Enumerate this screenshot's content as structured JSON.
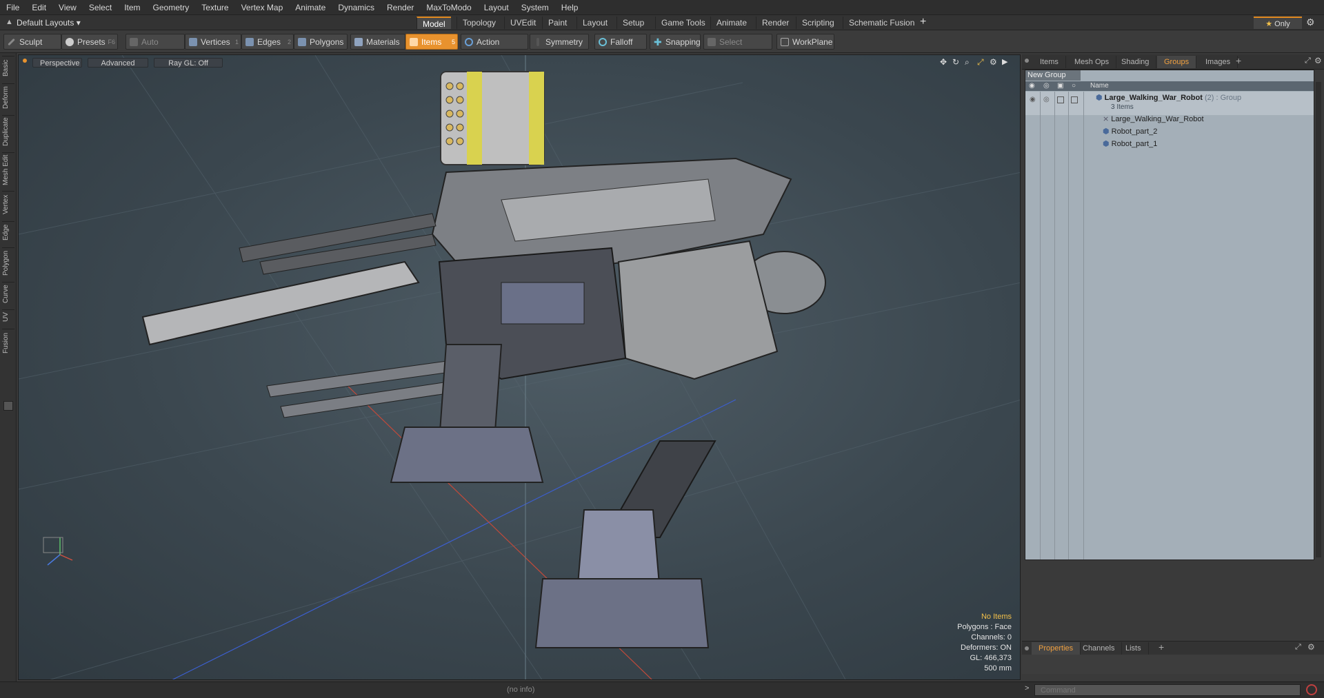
{
  "menu": [
    "File",
    "Edit",
    "View",
    "Select",
    "Item",
    "Geometry",
    "Texture",
    "Vertex Map",
    "Animate",
    "Dynamics",
    "Render",
    "MaxToModo",
    "Layout",
    "System",
    "Help"
  ],
  "layout": {
    "dropdown": "Default Layouts",
    "tabs": [
      "Model",
      "Topology",
      "UVEdit",
      "Paint",
      "Layout",
      "Setup",
      "Game Tools",
      "Animate",
      "Render",
      "Scripting",
      "Schematic Fusion"
    ],
    "active_tab": "Model",
    "only_label": "Only"
  },
  "toolbar": {
    "sculpt": "Sculpt",
    "presets": "Presets",
    "presets_key": "F6",
    "auto_select": "Auto Select",
    "vertices": "Vertices",
    "vertices_key": "1",
    "edges": "Edges",
    "edges_key": "2",
    "polygons": "Polygons",
    "materials": "Materials",
    "items": "Items",
    "items_key": "5",
    "action_center": "Action Center",
    "symmetry": "Symmetry",
    "falloff": "Falloff",
    "snapping": "Snapping",
    "select_through": "Select Through",
    "workplane": "WorkPlane"
  },
  "left_tabs": [
    "Basic",
    "Deform",
    "Duplicate",
    "Mesh Edit",
    "Vertex",
    "Edge",
    "Polygon",
    "Curve",
    "UV",
    "Fusion"
  ],
  "viewport": {
    "view": "Perspective",
    "shading": "Advanced",
    "raygl": "Ray GL: Off",
    "info": {
      "no_items": "No Items",
      "polygons": "Polygons : Face",
      "channels": "Channels: 0",
      "deformers": "Deformers: ON",
      "gl": "GL: 466,373",
      "scale": "500 mm"
    }
  },
  "right_panel": {
    "tabs": [
      "Items",
      "Mesh Ops",
      "Shading",
      "Groups",
      "Images"
    ],
    "active_tab": "Groups",
    "new_group": "New Group",
    "col_name": "Name",
    "group": {
      "name": "Large_Walking_War_Robot",
      "count": "(2)",
      "type": ": Group",
      "sub": "3 Items",
      "children": [
        "Large_Walking_War_Robot",
        "Robot_part_2",
        "Robot_part_1"
      ]
    },
    "bottom_tabs": [
      "Properties",
      "Channels",
      "Lists"
    ],
    "bottom_active": "Properties",
    "command_placeholder": "Command"
  },
  "status": "(no info)",
  "colors": {
    "accent": "#e8922e",
    "highlight": "#f2c04a"
  }
}
